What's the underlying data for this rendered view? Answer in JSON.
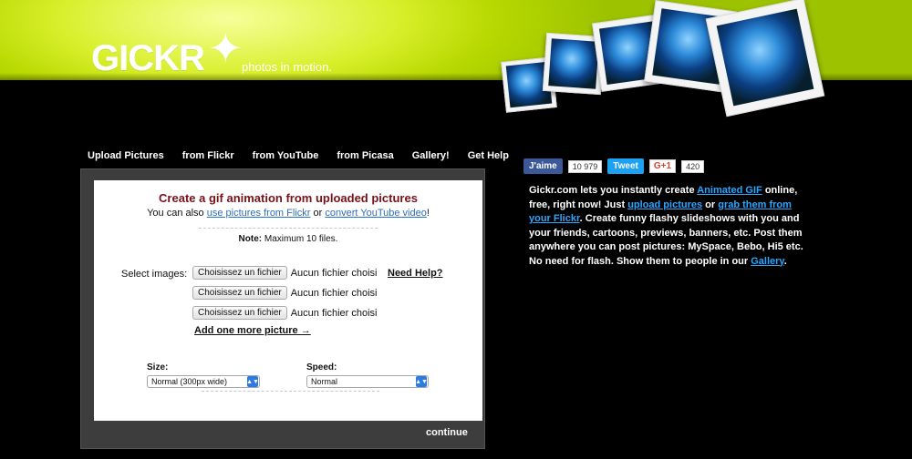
{
  "brand": {
    "logo_text": "GICKR",
    "tagline": "photos in motion."
  },
  "nav": {
    "items": [
      {
        "label": "Upload Pictures"
      },
      {
        "label": "from Flickr"
      },
      {
        "label": "from YouTube"
      },
      {
        "label": "from Picasa"
      },
      {
        "label": "Gallery!"
      },
      {
        "label": "Get Help"
      }
    ]
  },
  "form": {
    "title": "Create a gif animation from uploaded pictures",
    "subtitle_prefix": "You can also",
    "subtitle_link_1": "use pictures from Flickr",
    "subtitle_mid": "or",
    "subtitle_link_2": "convert YouTube video",
    "subtitle_suffix": "!",
    "note_label": "Note:",
    "note_text": "Maximum 10 files.",
    "select_images_label": "Select images:",
    "file_button_label": "Choisissez un fichier",
    "file_status": "Aucun fichier choisi",
    "help_label": "Need Help?",
    "add_more_label": "Add one more picture →",
    "size_label": "Size:",
    "size_value": "Normal (300px wide)",
    "speed_label": "Speed:",
    "speed_value": "Normal",
    "continue_label": "continue"
  },
  "social": {
    "facebook_label": "J'aime",
    "facebook_count": "10 979",
    "twitter_label": "Tweet",
    "gplus_label": "G+1",
    "gplus_count": "420"
  },
  "sidebar": {
    "part1": "Gickr.com lets you instantly create",
    "link1": "Animated GIF",
    "part2": "online, free, right now! Just",
    "link2": "upload pictures",
    "part3": "or",
    "link3": "grab them from your Flickr",
    "part4": ". Create funny flashy slideshows with you and your friends, cartoons, previews, banners, etc. Post them anywhere you can post pictures: MySpace, Bebo, Hi5 etc. No need for flash. Show them to people in our",
    "link4": "Gallery",
    "part5": "."
  }
}
